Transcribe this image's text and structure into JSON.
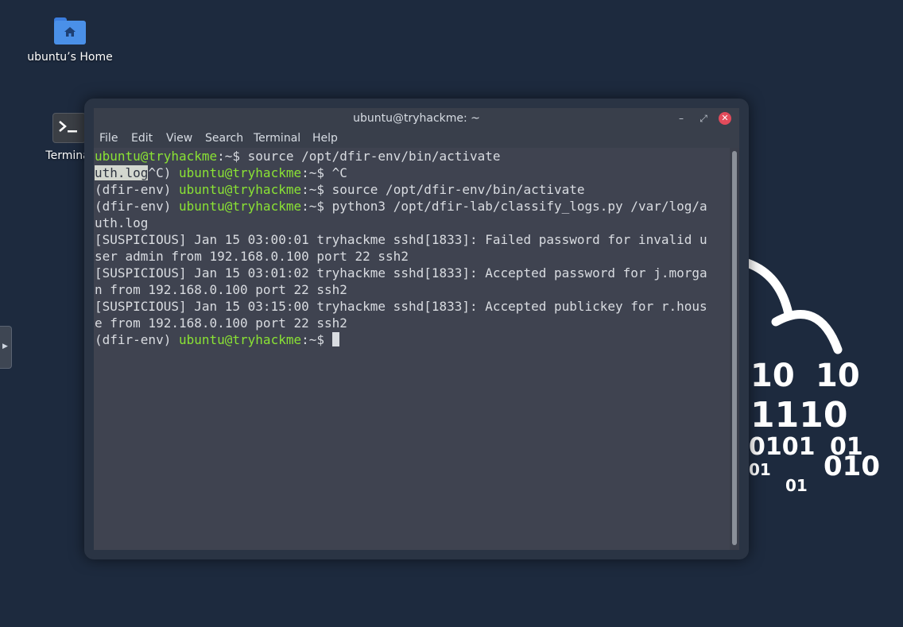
{
  "desktop": {
    "icons": [
      {
        "label": "ubuntu’s Home",
        "icon": "home-folder-icon"
      },
      {
        "label": "Terminal",
        "icon": "terminal-icon"
      }
    ]
  },
  "window": {
    "title": "ubuntu@tryhackme: ~",
    "controls": {
      "minimize": "–",
      "maximize": "⤢",
      "close": "✕"
    },
    "menu": [
      "File",
      "Edit",
      "View",
      "Search",
      "Terminal",
      "Help"
    ]
  },
  "terminal": {
    "env": "(dfir-env) ",
    "prompt_user": "ubuntu@tryhackme",
    "prompt_path": ":~",
    "prompt_sign": "$ ",
    "line1_cmd": "source /opt/dfir-env/bin/activate",
    "line2_selected": "uth.log",
    "line2_rest": "^C) ",
    "line2_cmd": "^C",
    "line3_cmd": "source /opt/dfir-env/bin/activate",
    "line4_cmd": "python3 /opt/dfir-lab/classify_logs.py /var/log/a",
    "line5": "uth.log",
    "line6": "[SUSPICIOUS] Jan 15 03:00:01 tryhackme sshd[1833]: Failed password for invalid u",
    "line7": "ser admin from 192.168.0.100 port 22 ssh2",
    "line8": "[SUSPICIOUS] Jan 15 03:01:02 tryhackme sshd[1833]: Accepted password for j.morga",
    "line9": "n from 192.168.0.100 port 22 ssh2",
    "line10": "[SUSPICIOUS] Jan 15 03:15:00 tryhackme sshd[1833]: Accepted publickey for r.hous",
    "line11": "e from 192.168.0.100 port 22 ssh2"
  },
  "wallpaper": {
    "binary": [
      "10",
      "10",
      "1110",
      "0101",
      "01",
      "01",
      "010",
      "01"
    ]
  },
  "colors": {
    "desktop_bg": "#1d2a3e",
    "terminal_bg": "#3f4350",
    "prompt_green": "#8ae234",
    "close_red": "#e24b5b"
  }
}
